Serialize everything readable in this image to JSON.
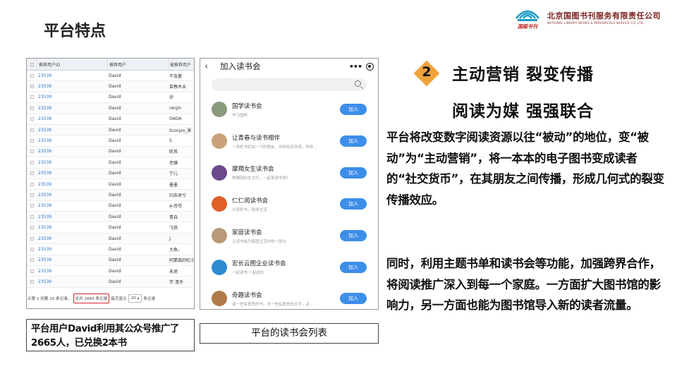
{
  "page": {
    "title": "平台特点"
  },
  "logo": {
    "company": "北京国图书刊服务有限责任公司",
    "company_en": "NATIONAL LIBRARY BOOKS & PERIODICALS SERVICE CO.,LTD.",
    "emblem_text": "国图书刊",
    "color": "#7b1f1f"
  },
  "table": {
    "headers": [
      "推荐用户ID",
      "推荐用户",
      "被推荐用户"
    ],
    "rows": [
      {
        "id": "23539",
        "user": "David",
        "invitee": "不急量"
      },
      {
        "id": "23539",
        "user": "David",
        "invitee": "苗春木业"
      },
      {
        "id": "23539",
        "user": "David",
        "invitee": "@"
      },
      {
        "id": "23539",
        "user": "David",
        "invitee": "renjin"
      },
      {
        "id": "23539",
        "user": "David",
        "invitee": "OAOA"
      },
      {
        "id": "23539",
        "user": "David",
        "invitee": "Scorpio_景"
      },
      {
        "id": "23539",
        "user": "David",
        "invitee": "Š"
      },
      {
        "id": "23539",
        "user": "David",
        "invitee": "昕风"
      },
      {
        "id": "23539",
        "user": "David",
        "invitee": "老骥"
      },
      {
        "id": "23539",
        "user": "David",
        "invitee": "宁儿"
      },
      {
        "id": "23539",
        "user": "David",
        "invitee": "墨墨"
      },
      {
        "id": "23539",
        "user": "David",
        "invitee": "归去来兮"
      },
      {
        "id": "23539",
        "user": "David",
        "invitee": "A-苍苍"
      },
      {
        "id": "23539",
        "user": "David",
        "invitee": "青自"
      },
      {
        "id": "23539",
        "user": "David",
        "invitee": "飞扬"
      },
      {
        "id": "23539",
        "user": "David",
        "invitee": "J."
      },
      {
        "id": "23539",
        "user": "David",
        "invitee": "大鱼。"
      },
      {
        "id": "23539",
        "user": "David",
        "invitee": "阿蒙森的吃士"
      },
      {
        "id": "23539",
        "user": "David",
        "invitee": "永旭"
      },
      {
        "id": "23539",
        "user": "David",
        "invitee": "学 清予"
      }
    ],
    "footer": {
      "range": "示第 1 到第 20 条记录，",
      "total": "总共 2665 条记录",
      "per_page_label": "每页显示",
      "per_page_value": "20 ▴",
      "per_page_suffix": "条记录"
    },
    "link_color": "#2a6fc9",
    "highlight_color": "#d0242a"
  },
  "phone": {
    "title": "加入读书会",
    "back": "‹",
    "menu": "•••",
    "clubs": [
      {
        "name": "国学读书会",
        "desc": "学习国粹",
        "join": "加入",
        "avatar_color": "#8a9a7e"
      },
      {
        "name": "让青春与读书相伴",
        "desc": "一本好书犹如一个好朋友，伴你经历风雨，伴你...",
        "join": "加入",
        "avatar_color": "#c9a27a"
      },
      {
        "name": "摩羯女生读书会",
        "desc": "摩羯座的女生们，一起来读书吧！",
        "join": "加入",
        "avatar_color": "#6a4a8a"
      },
      {
        "name": "仁仁阅读书会",
        "desc": "分享好书，陪伴生活",
        "join": "加入",
        "avatar_color": "#e0602a"
      },
      {
        "name": "家庭读书会",
        "desc": "让读书成为家庭生活中的一部分",
        "join": "加入",
        "avatar_color": "#b89a78"
      },
      {
        "name": "宏长云图企业读书会",
        "desc": "一起读书 一起成长",
        "join": "加入",
        "avatar_color": "#2e8bd0"
      },
      {
        "name": "奇趣读书会",
        "desc": "读一些有意思的书，写一些有意思的文字，走...",
        "join": "加入",
        "avatar_color": "#b07a4a"
      }
    ],
    "join_color": "#3d8ee8"
  },
  "captions": {
    "left": "平台用户David利用其公众号推广了2665人，已兑换2本书",
    "right": "平台的读书会列表"
  },
  "feature": {
    "number": "2",
    "badge_color": "#f0a33a",
    "headline1": "主动营销   裂变传播",
    "headline2": "阅读为媒   强强联合",
    "para1": "平台将改变数字阅读资源以往“被动”的地位，变“被动”为“主动营销”，将一本本的电子图书变成读者的“社交货币”，在其朋友之间传播，形成几何式的裂变传播效应。",
    "para2": "同时，利用主题书单和读书会等功能，加强跨界合作，将阅读推广深入到每一个家庭。一方面扩大图书馆的影响力，另一方面也能为图书馆导入新的读者流量。"
  }
}
